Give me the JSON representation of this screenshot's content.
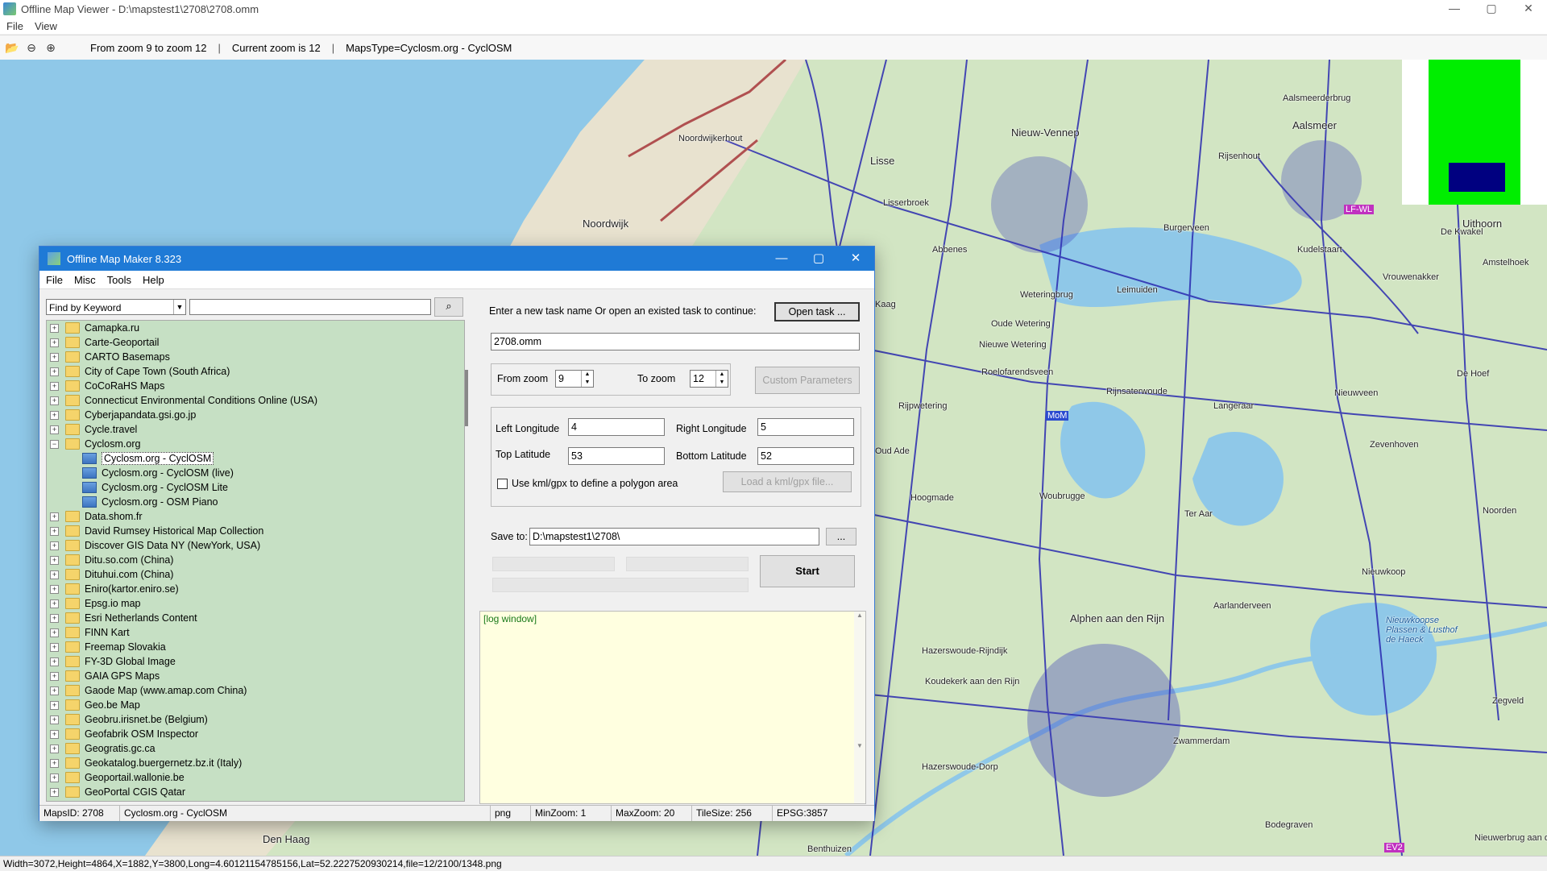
{
  "viewer": {
    "title": "Offline Map Viewer - D:\\mapstest1\\2708\\2708.omm",
    "menu": [
      "File",
      "View"
    ],
    "toolbar": {
      "zoom_range": "From zoom 9 to zoom 12",
      "current_zoom": "Current zoom is 12",
      "maps_type": "MapsType=Cyclosm.org - CyclOSM",
      "separator": "|"
    },
    "status": "Width=3072,Height=4864,X=1882,Y=3800,Long=4.60121154785156,Lat=52.2227520930214,file=12/2100/1348.png",
    "controls": {
      "minimize": "—",
      "maximize": "▢",
      "close": "✕"
    }
  },
  "map": {
    "places": [
      {
        "name": "Noordwijk"
      },
      {
        "name": "Noordwijkerhout"
      },
      {
        "name": "Lisse"
      },
      {
        "name": "Nieuw-Vennep"
      },
      {
        "name": "Aalsmeer"
      },
      {
        "name": "Aalsmeerderbrug"
      },
      {
        "name": "Lisserbroek"
      },
      {
        "name": "Abbenes"
      },
      {
        "name": "Burgerveen"
      },
      {
        "name": "Rijsenhout"
      },
      {
        "name": "Kudelstaart"
      },
      {
        "name": "Uithoorn"
      },
      {
        "name": "De Kwakel"
      },
      {
        "name": "Amstelhoek"
      },
      {
        "name": "Vrouwenakker"
      },
      {
        "name": "Leimuiden"
      },
      {
        "name": "Weteringbrug"
      },
      {
        "name": "Oude Wetering"
      },
      {
        "name": "Nieuwe Wetering"
      },
      {
        "name": "Roelofarendsveen"
      },
      {
        "name": "Rijnsaterwoude"
      },
      {
        "name": "Langeraar"
      },
      {
        "name": "Nieuwveen"
      },
      {
        "name": "De Hoef"
      },
      {
        "name": "Rijpwetering"
      },
      {
        "name": "Oud Ade"
      },
      {
        "name": "Zevenhoven"
      },
      {
        "name": "Hoogmade"
      },
      {
        "name": "Woubrugge"
      },
      {
        "name": "Ter Aar"
      },
      {
        "name": "Noorden"
      },
      {
        "name": "Alphen aan den Rijn"
      },
      {
        "name": "Nieuwkoop"
      },
      {
        "name": "Aarlanderveen"
      },
      {
        "name": "Nieuwkoopse Plassen & Lusthof de Haeck"
      },
      {
        "name": "Hazerswoude-Rijndijk"
      },
      {
        "name": "Koudekerk aan den Rijn"
      },
      {
        "name": "Zegveld"
      },
      {
        "name": "Zwammerdam"
      },
      {
        "name": "Hazerswoude-Dorp"
      },
      {
        "name": "Den Haag"
      },
      {
        "name": "Benthuizen"
      },
      {
        "name": "Bodegraven"
      },
      {
        "name": "Nieuwerbrug aan den Rijn"
      },
      {
        "name": "Kaag"
      }
    ],
    "route_tags": [
      "LF-WL",
      "MoM",
      "EV2"
    ],
    "colors": {
      "water": "#8fc8e8",
      "land": "#cfe0c0",
      "roads": "#2a2ab0",
      "overview_green": "#00ee00",
      "overview_blue": "#000080"
    }
  },
  "dialog": {
    "title": "Offline Map Maker 8.323",
    "menu": [
      "File",
      "Misc",
      "Tools",
      "Help"
    ],
    "controls": {
      "minimize": "—",
      "maximize": "▢",
      "close": "✕"
    },
    "search": {
      "mode": "Find by Keyword",
      "query": "",
      "button_icon": "search-icon"
    },
    "tree": [
      {
        "label": "Camapka.ru",
        "type": "folder"
      },
      {
        "label": "Carte-Geoportail",
        "type": "folder"
      },
      {
        "label": "CARTO Basemaps",
        "type": "folder"
      },
      {
        "label": "City of Cape Town (South Africa)",
        "type": "folder"
      },
      {
        "label": "CoCoRaHS Maps",
        "type": "folder"
      },
      {
        "label": "Connecticut Environmental Conditions Online (USA)",
        "type": "folder"
      },
      {
        "label": "Cyberjapandata.gsi.go.jp",
        "type": "folder"
      },
      {
        "label": "Cycle.travel",
        "type": "folder"
      },
      {
        "label": "Cyclosm.org",
        "type": "open-folder"
      },
      {
        "label": "Cyclosm.org - CyclOSM",
        "type": "map",
        "selected": true
      },
      {
        "label": "Cyclosm.org - CyclOSM (live)",
        "type": "map"
      },
      {
        "label": "Cyclosm.org - CyclOSM Lite",
        "type": "map"
      },
      {
        "label": "Cyclosm.org - OSM Piano",
        "type": "map"
      },
      {
        "label": "Data.shom.fr",
        "type": "folder"
      },
      {
        "label": "David Rumsey Historical Map Collection",
        "type": "folder"
      },
      {
        "label": "Discover GIS Data NY (NewYork, USA)",
        "type": "folder"
      },
      {
        "label": "Ditu.so.com (China)",
        "type": "folder"
      },
      {
        "label": "Dituhui.com (China)",
        "type": "folder"
      },
      {
        "label": "Eniro(kartor.eniro.se)",
        "type": "folder"
      },
      {
        "label": "Epsg.io map",
        "type": "folder"
      },
      {
        "label": "Esri Netherlands Content",
        "type": "folder"
      },
      {
        "label": "FINN Kart",
        "type": "folder"
      },
      {
        "label": "Freemap Slovakia",
        "type": "folder"
      },
      {
        "label": "FY-3D Global Image",
        "type": "folder"
      },
      {
        "label": "GAIA GPS Maps",
        "type": "folder"
      },
      {
        "label": "Gaode Map (www.amap.com China)",
        "type": "folder"
      },
      {
        "label": "Geo.be Map",
        "type": "folder"
      },
      {
        "label": "Geobru.irisnet.be (Belgium)",
        "type": "folder"
      },
      {
        "label": "Geofabrik OSM Inspector",
        "type": "folder"
      },
      {
        "label": "Geogratis.gc.ca",
        "type": "folder"
      },
      {
        "label": "Geokatalog.buergernetz.bz.it (Italy)",
        "type": "folder"
      },
      {
        "label": "Geoportail.wallonie.be",
        "type": "folder"
      },
      {
        "label": "GeoPortal CGIS Qatar",
        "type": "folder"
      }
    ],
    "task": {
      "prompt": "Enter a new task name Or open an existed task to continue:",
      "open_button": "Open task ...",
      "name": "2708.omm"
    },
    "zoom": {
      "from_label": "From zoom",
      "from_value": "9",
      "to_label": "To zoom",
      "to_value": "12",
      "custom_button": "Custom Parameters"
    },
    "bounds": {
      "left_label": "Left Longitude",
      "left_value": "4",
      "right_label": "Right Longitude",
      "right_value": "5",
      "top_label": "Top Latitude",
      "top_value": "53",
      "bottom_label": "Bottom Latitude",
      "bottom_value": "52",
      "kml_label": "Use kml/gpx to define a polygon area",
      "kml_checked": false,
      "load_button": "Load a kml/gpx file..."
    },
    "save": {
      "label": "Save to:",
      "path": "D:\\mapstest1\\2708\\",
      "browse_button": "...",
      "start_button": "Start"
    },
    "log": "[log window]",
    "status": {
      "maps_id": "MapsID: 2708",
      "map_name": "Cyclosm.org - CyclOSM",
      "format": "png",
      "min_zoom": "MinZoom: 1",
      "max_zoom": "MaxZoom: 20",
      "tile_size": "TileSize: 256",
      "epsg": "EPSG:3857"
    }
  }
}
